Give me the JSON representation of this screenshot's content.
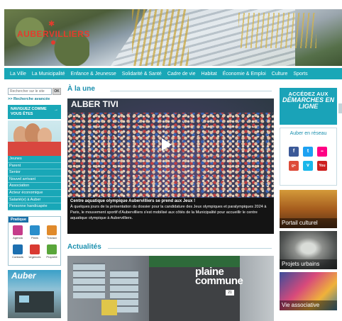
{
  "header": {
    "logo_text": "AUBERVILLIERS"
  },
  "nav": [
    "La Ville",
    "La Municipalité",
    "Enfance & Jeunesse",
    "Solidarité & Santé",
    "Cadre de vie",
    "Habitat",
    "Économie & Emploi",
    "Culture",
    "Sports"
  ],
  "sidebar": {
    "search_placeholder": "Rechercher sur le site",
    "search_button": "OK",
    "advanced_search": ">> Recherche avancée",
    "naviguez": "NAVIGUEZ COMME VOUS ÊTES",
    "audiences": [
      "Jeunes",
      "Parent",
      "Senior",
      "Nouvel arrivant",
      "Association",
      "Acteur économique",
      "Salarié(e) à Auber",
      "Personne handicapée"
    ],
    "pratique": {
      "title": "Pratique",
      "items": [
        "Agenda",
        "Plans",
        "Travaux",
        "Contacts",
        "Urgences",
        "Propreté"
      ]
    },
    "magazine_title": "Auber"
  },
  "une": {
    "title": "À la une",
    "video_brand": "ALBER TIVI",
    "caption_title": "Centre aquatique olympique Aubervilliers se prend aux Jeux !",
    "caption_body": "À quelques jours de la présentation du dossier pour la candidature des Jeux olympiques et paralympiques 2024 à Paris, le mouvement sportif d'Aubervilliers s'est mobilisé aux côtés de la Municipalité pour accueillir le centre aquatique olympique à Aubervilliers."
  },
  "actualites": {
    "title": "Actualités",
    "sign": "plaine commune",
    "number": "21"
  },
  "right": {
    "demarches_line1": "ACCÉDEZ AUX",
    "demarches_line2": "DÉMARCHES EN LIGNE",
    "reseau_title": "Auber en réseau",
    "social": [
      "f",
      "t",
      "••",
      "g+",
      "v",
      "You"
    ],
    "promos": [
      "Portail culturel",
      "Projets urbains",
      "Vie associative"
    ]
  },
  "colors": {
    "accent": "#19a7b7",
    "title": "#1a8fae",
    "logo": "#e43b2e"
  }
}
